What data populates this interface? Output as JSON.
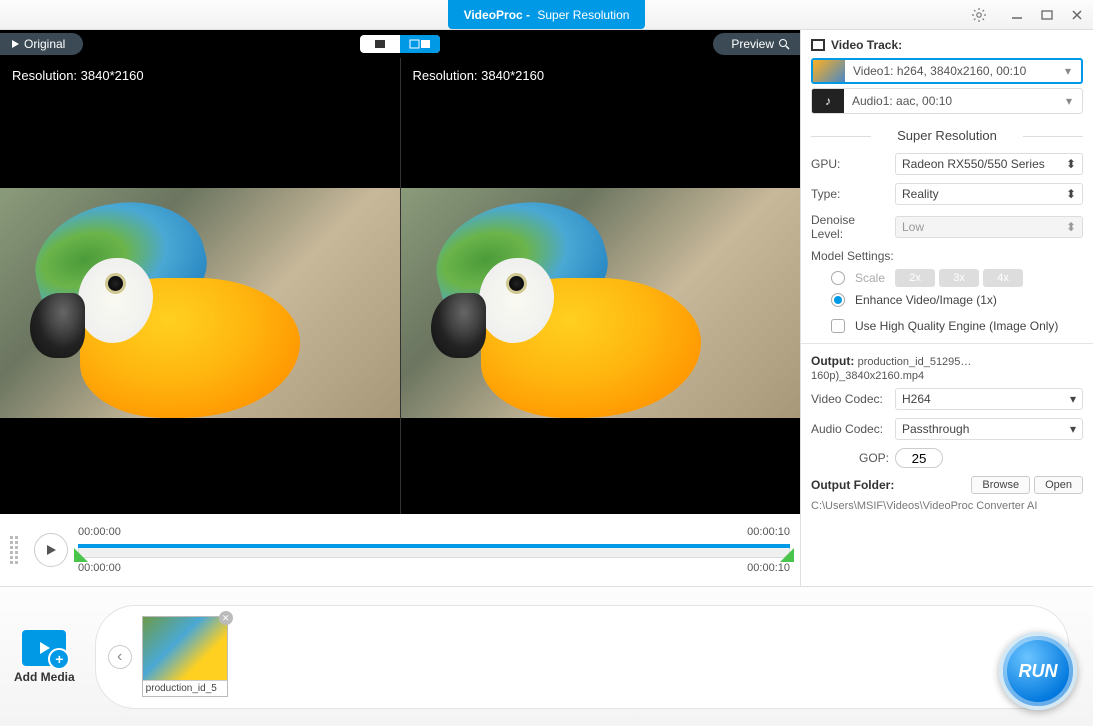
{
  "titlebar": {
    "app": "VideoProc",
    "sub": "Super Resolution"
  },
  "preview": {
    "original_tab": "Original",
    "preview_tab": "Preview",
    "left_res": "Resolution: 3840*2160",
    "right_res": "Resolution: 3840*2160"
  },
  "timeline": {
    "top_start": "00:00:00",
    "top_end": "00:00:10",
    "bot_start": "00:00:00",
    "bot_end": "00:00:10"
  },
  "tracks": {
    "title": "Video Track:",
    "video": "Video1: h264, 3840x2160, 00:10",
    "audio": "Audio1: aac, 00:10"
  },
  "sr": {
    "heading": "Super Resolution",
    "gpu_label": "GPU:",
    "gpu_value": "Radeon RX550/550 Series",
    "type_label": "Type:",
    "type_value": "Reality",
    "denoise_label": "Denoise Level:",
    "denoise_value": "Low",
    "model_label": "Model Settings:",
    "scale_label": "Scale",
    "scale_opts": [
      "2x",
      "3x",
      "4x"
    ],
    "enhance_label": "Enhance Video/Image (1x)",
    "hq_label": "Use High Quality Engine (Image Only)"
  },
  "output": {
    "label": "Output:",
    "file": "production_id_51295…160p)_3840x2160.mp4",
    "vcodec_label": "Video Codec:",
    "vcodec": "H264",
    "acodec_label": "Audio Codec:",
    "acodec": "Passthrough",
    "gop_label": "GOP:",
    "gop": "25",
    "folder_label": "Output Folder:",
    "browse": "Browse",
    "open": "Open",
    "path": "C:\\Users\\MSIF\\Videos\\VideoProc Converter AI"
  },
  "bottom": {
    "add": "Add Media",
    "item_name": "production_id_5",
    "run": "RUN"
  }
}
